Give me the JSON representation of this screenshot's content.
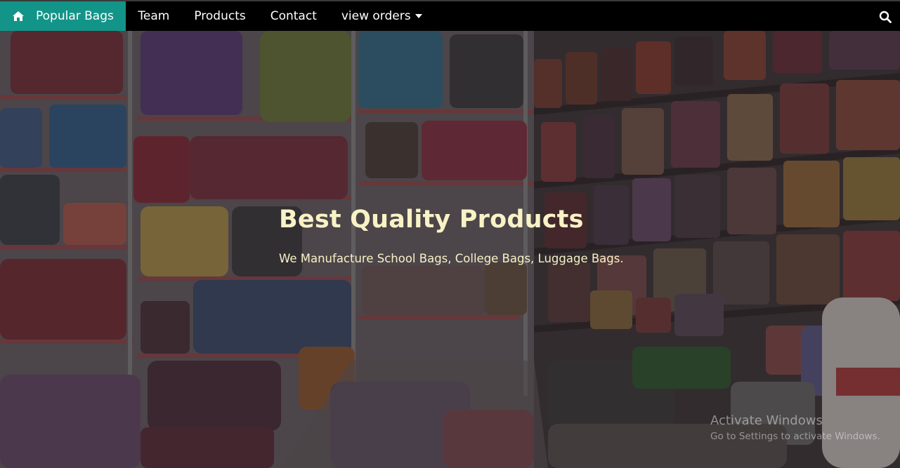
{
  "nav": {
    "brand_label": "Popular Bags",
    "items": [
      {
        "label": "Team"
      },
      {
        "label": "Products"
      },
      {
        "label": "Contact"
      },
      {
        "label": "view orders"
      }
    ],
    "brand_color": "#139488"
  },
  "hero": {
    "title": "Best Quality Products",
    "subtitle": "We Manufacture School Bags, College Bags, Luggage Bags.",
    "text_color": "#f8f2c6"
  },
  "watermark": {
    "title": "Activate Windows",
    "subtitle": "Go to Settings to activate Windows."
  },
  "icons": {
    "home": "home-icon",
    "dropdown": "caret-down-icon",
    "search": "search-icon"
  }
}
